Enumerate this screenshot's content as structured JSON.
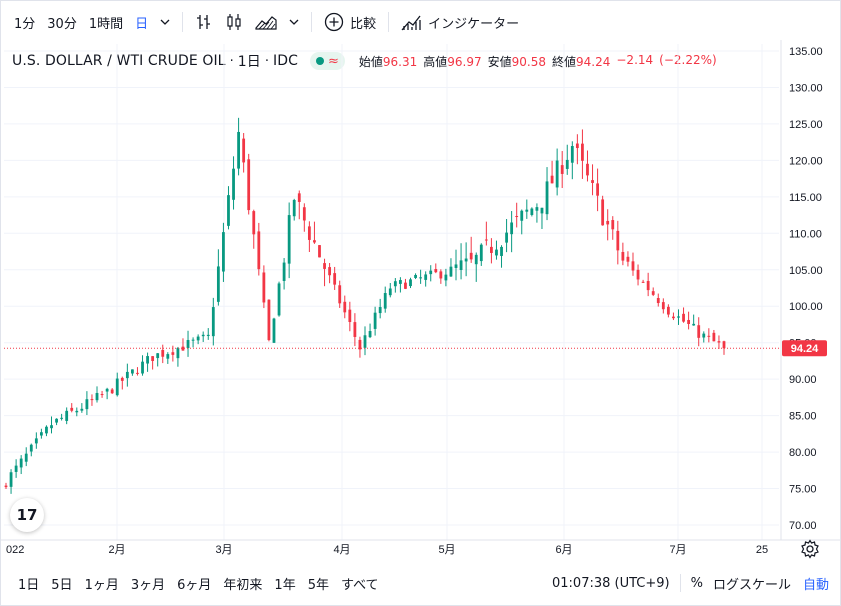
{
  "toolbar": {
    "intervals": [
      "1分",
      "30分",
      "1時間",
      "日"
    ],
    "active_interval": "日",
    "compare_label": "比較",
    "indicators_label": "インジケーター"
  },
  "legend": {
    "symbol": "U.S. DOLLAR / WTI CRUDE OIL",
    "interval": "1日",
    "exchange": "IDC",
    "open_label": "始値",
    "open": "96.31",
    "high_label": "高値",
    "high": "96.97",
    "low_label": "安値",
    "low": "90.58",
    "close_label": "終値",
    "close": "94.24",
    "change": "−2.14",
    "change_pct": "(−2.22%)"
  },
  "price_axis": {
    "labels": [
      "135.00",
      "130.00",
      "125.00",
      "120.00",
      "115.00",
      "110.00",
      "105.00",
      "100.00",
      "95.00",
      "90.00",
      "85.00",
      "80.00",
      "75.00",
      "70.00"
    ],
    "last_price": "94.24"
  },
  "time_axis": {
    "labels": [
      "022",
      "2月",
      "3月",
      "4月",
      "5月",
      "6月",
      "7月",
      "25"
    ]
  },
  "bottom_bar": {
    "ranges": [
      "1日",
      "5日",
      "1ヶ月",
      "3ヶ月",
      "6ヶ月",
      "年初来",
      "1年",
      "5年",
      "すべて"
    ],
    "clock": "01:07:38 (UTC+9)",
    "percent": "%",
    "log_scale": "ログスケール",
    "auto": "自動"
  },
  "colors": {
    "up": "#089981",
    "down": "#f23645",
    "accent": "#2962ff",
    "grid": "#f0f3fa"
  },
  "chart_data": {
    "type": "candlestick",
    "ylim": [
      68,
      136
    ],
    "last_price": 94.24,
    "approx_close_path": [
      {
        "date": "2022-01-03",
        "close": 76.0
      },
      {
        "date": "2022-01-14",
        "close": 83.8
      },
      {
        "date": "2022-01-31",
        "close": 88.2
      },
      {
        "date": "2022-02-11",
        "close": 93.1
      },
      {
        "date": "2022-02-28",
        "close": 95.7
      },
      {
        "date": "2022-03-08",
        "close": 123.7
      },
      {
        "date": "2022-03-16",
        "close": 95.0
      },
      {
        "date": "2022-03-23",
        "close": 114.9
      },
      {
        "date": "2022-04-11",
        "close": 94.3
      },
      {
        "date": "2022-04-19",
        "close": 102.6
      },
      {
        "date": "2022-05-11",
        "close": 105.7
      },
      {
        "date": "2022-05-31",
        "close": 114.7
      },
      {
        "date": "2022-06-08",
        "close": 122.1
      },
      {
        "date": "2022-06-22",
        "close": 106.2
      },
      {
        "date": "2022-07-05",
        "close": 99.5
      },
      {
        "date": "2022-07-13",
        "close": 96.3
      },
      {
        "date": "2022-07-20",
        "close": 94.24
      }
    ]
  }
}
